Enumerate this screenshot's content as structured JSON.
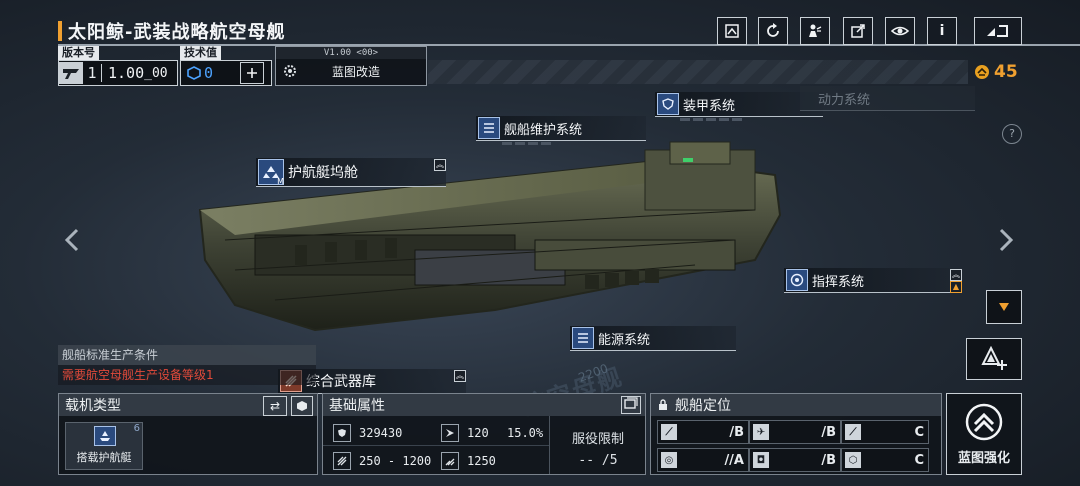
{
  "header": {
    "title": "太阳鲸-武装战略航空母舰",
    "version_label": "版本号",
    "version_tier": "1",
    "version_value": "1.00",
    "version_suffix": "00",
    "tech_label": "技术值",
    "tech_value": "0",
    "blueprint_version": "V1.00 <00>",
    "blueprint_mod_label": "蓝图改造",
    "currency": "45",
    "icons": [
      "archive-icon",
      "refresh-icon",
      "share-person-icon",
      "external-link-icon",
      "view-icon",
      "info-icon",
      "back-icon"
    ],
    "info_glyph": "i",
    "help_glyph": "?"
  },
  "hotspots": {
    "armor": "装甲系统",
    "power": "动力系统",
    "maintenance": "舰船维护系统",
    "escort_dock": "护航艇坞舱",
    "escort_badge": "M",
    "command": "指挥系统",
    "energy": "能源系统",
    "weapons": "综合武器库"
  },
  "production": {
    "title": "舰船标准生产条件",
    "warning": "需要航空母舰生产设备等级1"
  },
  "aircraft": {
    "title": "载机类型",
    "item_label": "搭载护航艇",
    "item_count": "6"
  },
  "attributes": {
    "title": "基础属性",
    "hp": "329430",
    "armor": "120",
    "armor_pct": "15.0%",
    "speed": "250 - 1200",
    "cruise": "1250",
    "service_limit_label": "服役限制",
    "service_limit_value": "-- /5"
  },
  "positioning": {
    "title": "舰船定位",
    "grades": [
      {
        "icon": "anti-ship-icon",
        "value": "/B"
      },
      {
        "icon": "anti-air-icon",
        "value": "/B"
      },
      {
        "icon": "siege-icon",
        "value": "C"
      },
      {
        "icon": "support-icon",
        "value": "//A"
      },
      {
        "icon": "defense-icon",
        "value": "/B"
      },
      {
        "icon": "utility-icon",
        "value": "C"
      }
    ]
  },
  "enhance": {
    "label": "蓝图强化"
  },
  "hull_number": "2200",
  "watermark": "航空母舰",
  "colors": {
    "accent": "#f0a030",
    "warning": "#e04a3a",
    "icon_blue": "#2a4a7e"
  }
}
